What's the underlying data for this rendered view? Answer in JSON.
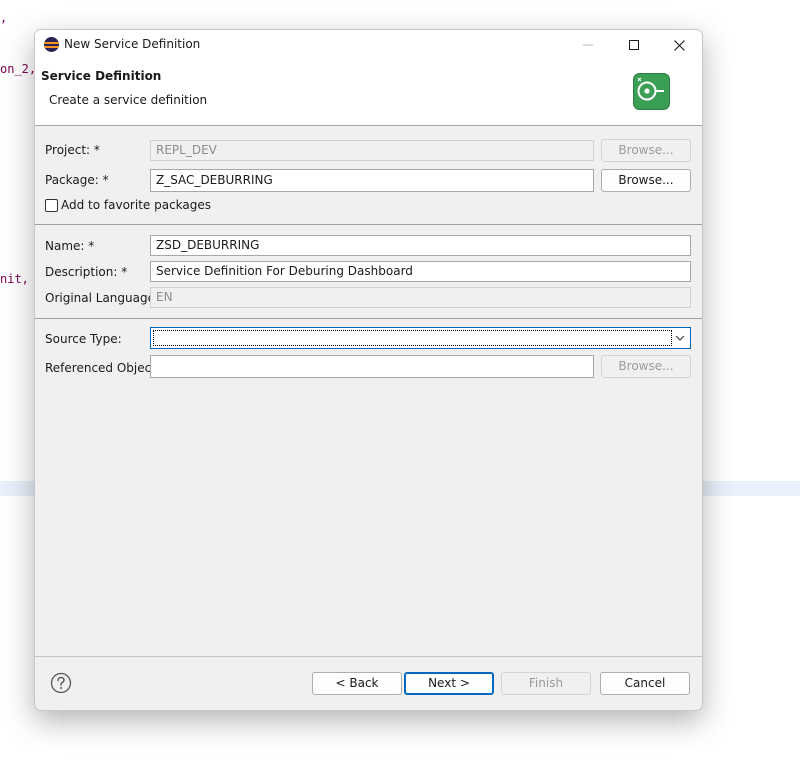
{
  "background": {
    "code_lines": [
      ",",
      "on_2,",
      "nit,"
    ]
  },
  "dialog": {
    "title": "New Service Definition",
    "header": {
      "title": "Service Definition",
      "subtitle": "Create a service definition",
      "icon": "service-definition-wizard-icon"
    },
    "form": {
      "project": {
        "label": "Project: *",
        "value": "REPL_DEV",
        "browse": "Browse..."
      },
      "package": {
        "label": "Package: *",
        "value": "Z_SAC_DEBURRING",
        "browse": "Browse..."
      },
      "favorite": {
        "label": "Add to favorite packages",
        "checked": false
      },
      "name": {
        "label": "Name: *",
        "value": "ZSD_DEBURRING"
      },
      "description": {
        "label": "Description: *",
        "value": "Service Definition For Deburing Dashboard"
      },
      "language": {
        "label": "Original Language:",
        "value": "EN"
      },
      "source_type": {
        "label": "Source Type:",
        "value": ""
      },
      "referenced_object": {
        "label": "Referenced Object:",
        "value": "",
        "browse": "Browse..."
      }
    },
    "footer": {
      "back": "< Back",
      "next": "Next >",
      "finish": "Finish",
      "cancel": "Cancel"
    }
  },
  "colors": {
    "dialog_bg": "#f0f0f0",
    "accent": "#0067c0",
    "keyword": "#7f0055",
    "icon_green": "#3a9f55"
  }
}
